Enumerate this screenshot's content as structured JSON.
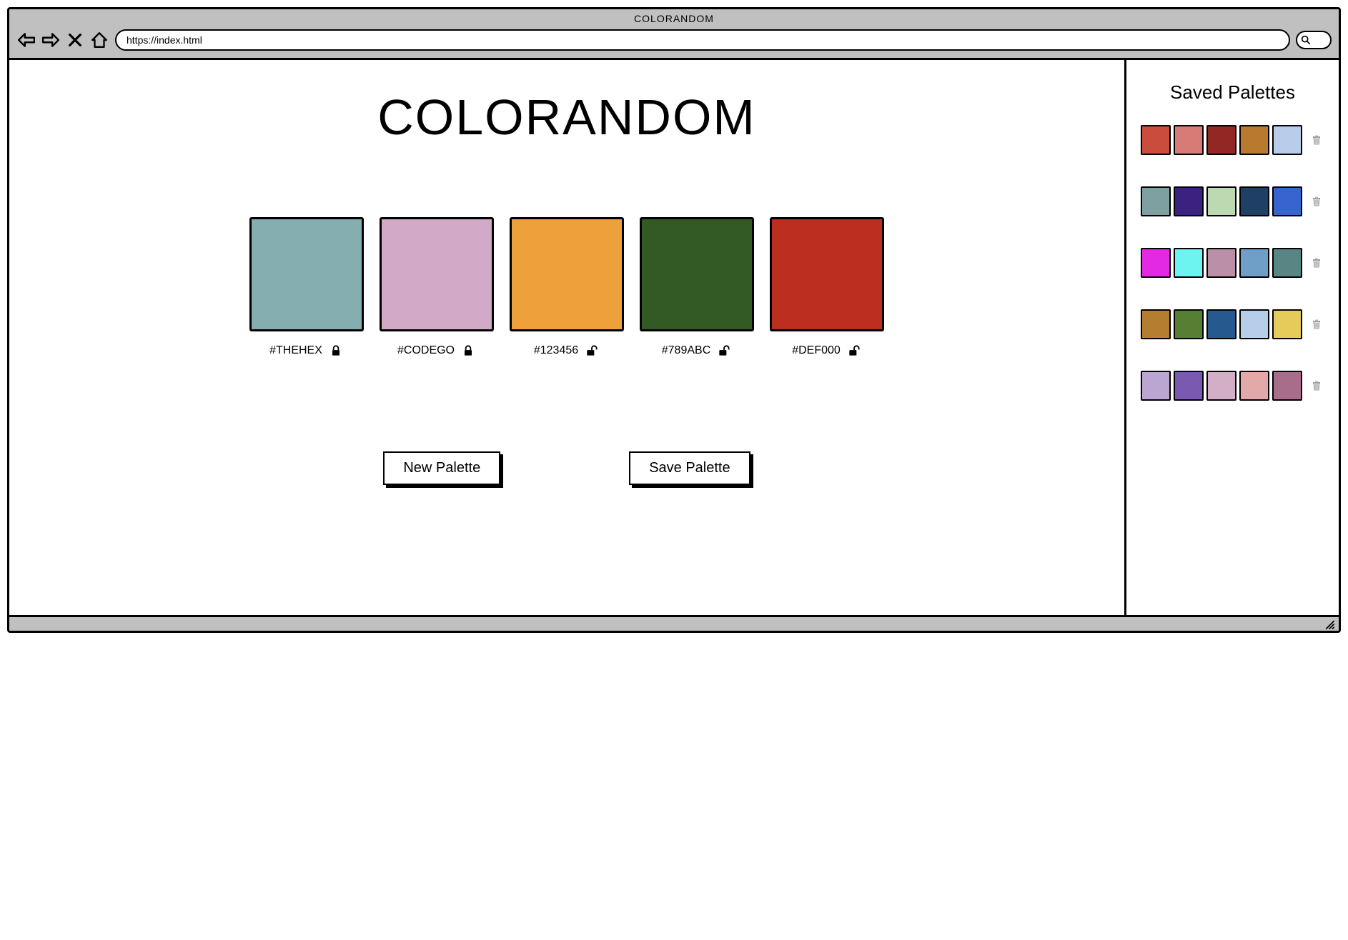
{
  "browser": {
    "title": "COLORANDOM",
    "url": "https://index.html"
  },
  "app": {
    "title": "COLORANDOM"
  },
  "palette": [
    {
      "hex": "#THEHEX",
      "color": "#84aeb0",
      "locked": true
    },
    {
      "hex": "#CODEGO",
      "color": "#d2a9c6",
      "locked": true
    },
    {
      "hex": "#123456",
      "color": "#eea13a",
      "locked": false
    },
    {
      "hex": "#789ABC",
      "color": "#335924",
      "locked": false
    },
    {
      "hex": "#DEF000",
      "color": "#bc2f20",
      "locked": false
    }
  ],
  "buttons": {
    "new_palette": "New Palette",
    "save_palette": "Save Palette"
  },
  "sidebar": {
    "title": "Saved Palettes",
    "saved": [
      [
        "#c94c3c",
        "#d87a75",
        "#922723",
        "#b9792e",
        "#b9cdea"
      ],
      [
        "#7ea0a0",
        "#3b2280",
        "#bdd9b2",
        "#1f3f66",
        "#3765cf"
      ],
      [
        "#e429e4",
        "#6ef3f3",
        "#bb8fa8",
        "#6f9ec6",
        "#578685"
      ],
      [
        "#b47d2f",
        "#567f34",
        "#265a8f",
        "#b6ceea",
        "#e5cb5a"
      ],
      [
        "#bba6d2",
        "#7a59b0",
        "#d2afc6",
        "#e3a9a9",
        "#a96d8b"
      ]
    ]
  }
}
